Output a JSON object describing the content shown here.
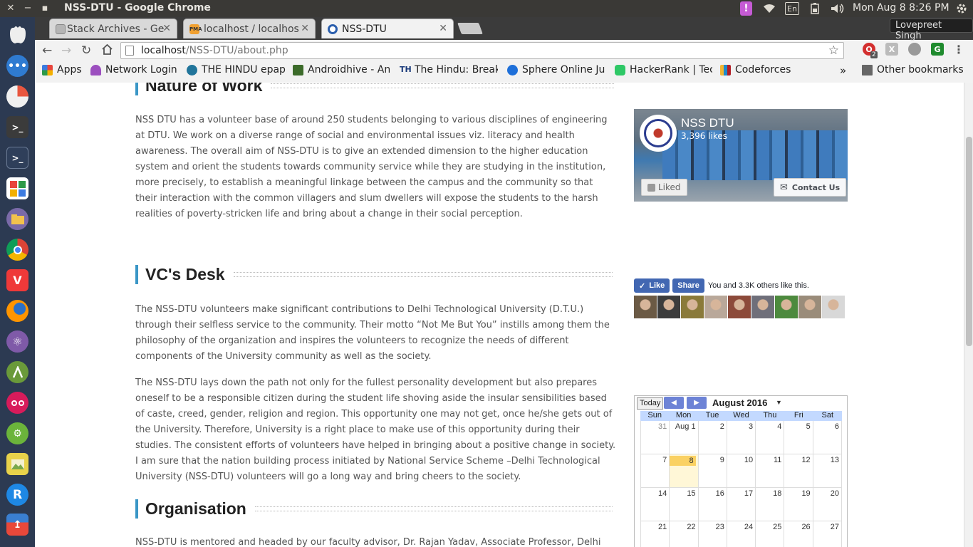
{
  "os_bar": {
    "window_title": "NSS-DTU - Google Chrome",
    "keyboard_layout": "En",
    "clock": "Mon Aug  8  8:26 PM"
  },
  "launcher": {
    "icons": [
      "ubuntu-logo-icon",
      "dash-icon",
      "disk-usage-icon",
      "terminal-icon",
      "terminal-2-icon",
      "app-grid-icon",
      "files-icon",
      "chrome-icon",
      "vivaldi-icon",
      "firefox-icon",
      "atom-icon",
      "android-studio-icon",
      "flickr-icon",
      "android-icon",
      "image-viewer-icon",
      "reverse-r-icon",
      "software-center-icon"
    ]
  },
  "tabs": [
    {
      "title": "Stack Archives - Ge",
      "favicon_color": "#999999"
    },
    {
      "title": "localhost / localhos",
      "favicon_color": "#f0a030"
    },
    {
      "title": "NSS-DTU",
      "favicon_color": "#2b5fad"
    }
  ],
  "profile_name": "Lovepreet Singh",
  "address_bar": {
    "host": "localhost",
    "path": "/NSS-DTU/about.php"
  },
  "extension_badge": "2",
  "bookmarks": {
    "apps": "Apps",
    "items": [
      {
        "label": "Network Login",
        "color": "#9c4fbf"
      },
      {
        "label": "THE HINDU epap",
        "color": "#21759b"
      },
      {
        "label": "Androidhive - An",
        "color": "#3c6b2a"
      },
      {
        "label": "The Hindu: Break",
        "color": "#1a3a7a"
      },
      {
        "label": "Sphere Online Ju",
        "color": "#1e6fd9"
      },
      {
        "label": "HackerRank | Tec",
        "color": "#2ec866"
      },
      {
        "label": "Codeforces",
        "color": "#f2b632"
      }
    ],
    "overflow": "»",
    "other": "Other bookmarks"
  },
  "sections": {
    "nature": {
      "heading": "Nature of Work",
      "paragraph": "NSS DTU has a volunteer base of around 250 students belonging to various disciplines of engineering at DTU. We work on a diverse range of social and environmental issues viz. literacy and health awareness. The overall aim of NSS-DTU is to give an extended dimension to the higher education system and orient the students towards community service while they are studying in the institution, more precisely, to establish a meaningful linkage between the campus and the community so that their interaction with the common villagers and slum dwellers will expose the students to the harsh realities of poverty-stricken life and bring about a change in their social perception."
    },
    "vc": {
      "heading": "VC's Desk",
      "paragraph1": "The NSS-DTU volunteers make significant contributions to Delhi Technological University (D.T.U.) through their selfless service to the community. Their motto “Not Me But You” instills among them the philosophy of the organization and inspires the volunteers to recognize the needs of different components of the University community as well as the society.",
      "paragraph2": "The NSS-DTU lays down the path not only for the fullest personality development but also prepares oneself to be a responsible citizen during the student life shoving aside the insular sensibilities based of caste, creed, gender, religion and region. This opportunity one may not get, once he/she gets out of the University. Therefore, University is a right place to make use of this opportunity during their studies. The consistent efforts of volunteers have helped in bringing about a positive change in society. I am sure that the nation building process initiated by National Service Scheme –Delhi Technological University (NSS-DTU) volunteers will go a long way and bring cheers to the society."
    },
    "organisation": {
      "heading": "Organisation",
      "paragraph": "NSS-DTU is mentored and headed by our faculty advisor, Dr. Rajan Yadav, Associate Professor, Delhi"
    }
  },
  "facebook": {
    "page_name": "NSS DTU",
    "likes": "3,396 likes",
    "liked_label": "Liked",
    "contact_label": "Contact Us",
    "like_label": "Like",
    "share_label": "Share",
    "social_text": "You and 3.3K others like this.",
    "face_colors": [
      "#6b5a45",
      "#3c3c3c",
      "#8a7a3a",
      "#b9a89a",
      "#8c4a3a",
      "#6f6f7a",
      "#4d8a3e",
      "#9a8c7a",
      "#d8d8d8"
    ]
  },
  "calendar": {
    "today_label": "Today",
    "prev_label": "◀",
    "next_label": "▶",
    "month_label": "August 2016",
    "day_names": [
      "Sun",
      "Mon",
      "Tue",
      "Wed",
      "Thu",
      "Fri",
      "Sat"
    ],
    "weeks": [
      [
        "31",
        "Aug 1",
        "2",
        "3",
        "4",
        "5",
        "6"
      ],
      [
        "7",
        "8",
        "9",
        "10",
        "11",
        "12",
        "13"
      ],
      [
        "14",
        "15",
        "16",
        "17",
        "18",
        "19",
        "20"
      ],
      [
        "21",
        "22",
        "23",
        "24",
        "25",
        "26",
        "27"
      ]
    ],
    "today_day": "8"
  }
}
